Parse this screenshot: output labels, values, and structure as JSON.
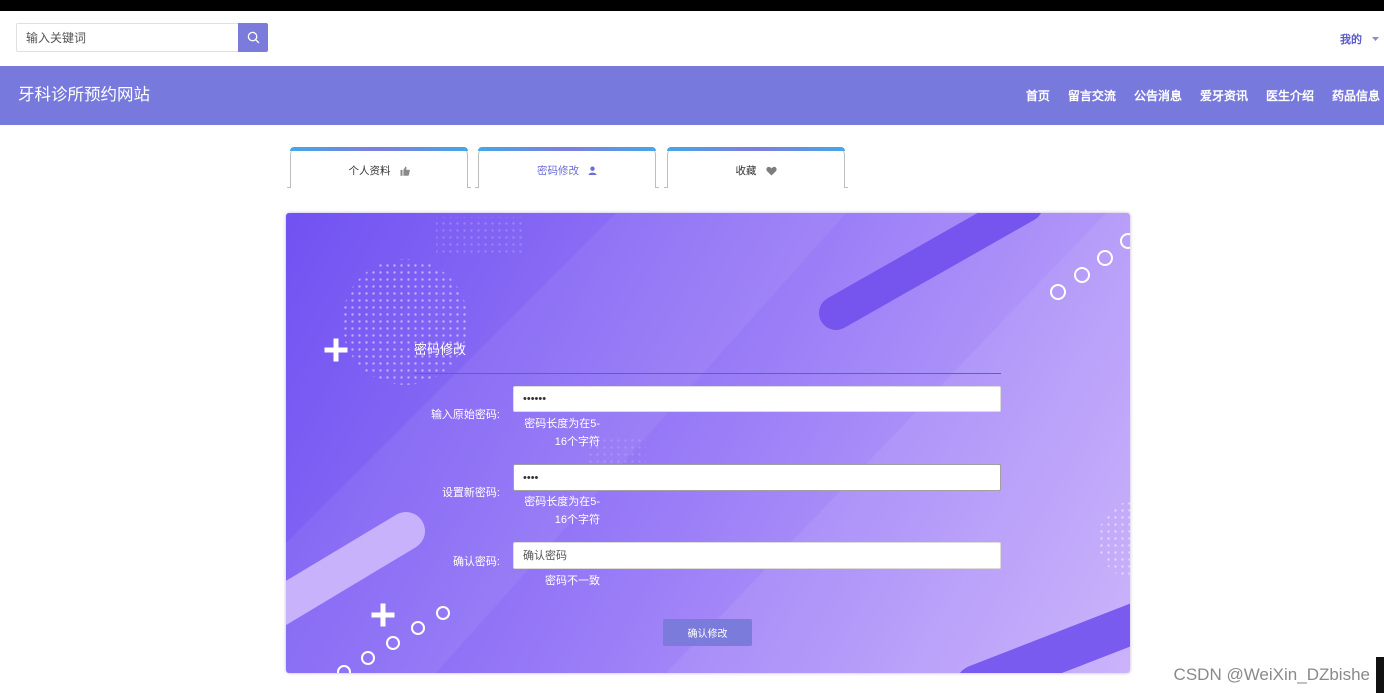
{
  "colors": {
    "accent": "#7b7bdc",
    "nav_background": "#7879dd",
    "active_tab_text": "#6c6cd4",
    "user_menu_text": "#5c5cca"
  },
  "header": {
    "search": {
      "placeholder": "输入关键词",
      "icon": "search-icon"
    },
    "user_menu": {
      "label": "我的",
      "icon": "caret-down-icon"
    }
  },
  "nav": {
    "site_title": "牙科诊所预约网站",
    "items": [
      {
        "label": "首页"
      },
      {
        "label": "留言交流"
      },
      {
        "label": "公告消息"
      },
      {
        "label": "爱牙资讯"
      },
      {
        "label": "医生介绍"
      },
      {
        "label": "药品信息"
      }
    ]
  },
  "tabs": [
    {
      "label": "个人资料",
      "icon": "thumbs-up-icon",
      "active": false
    },
    {
      "label": "密码修改",
      "icon": "user-icon",
      "active": true
    },
    {
      "label": "收藏",
      "icon": "heart-icon",
      "active": false
    }
  ],
  "form": {
    "title": "密码修改",
    "fields": [
      {
        "label": "输入原始密码:",
        "value": "••••••",
        "hint_lines": [
          "密码长度为在5-",
          "16个字符"
        ]
      },
      {
        "label": "设置新密码:",
        "value": "••••",
        "hint_lines": [
          "密码长度为在5-",
          "16个字符"
        ]
      },
      {
        "label": "确认密码:",
        "placeholder": "确认密码",
        "hint_lines": [
          "密码不一致"
        ]
      }
    ],
    "submit_label": "确认修改"
  },
  "watermark": "CSDN @WeiXin_DZbishe"
}
